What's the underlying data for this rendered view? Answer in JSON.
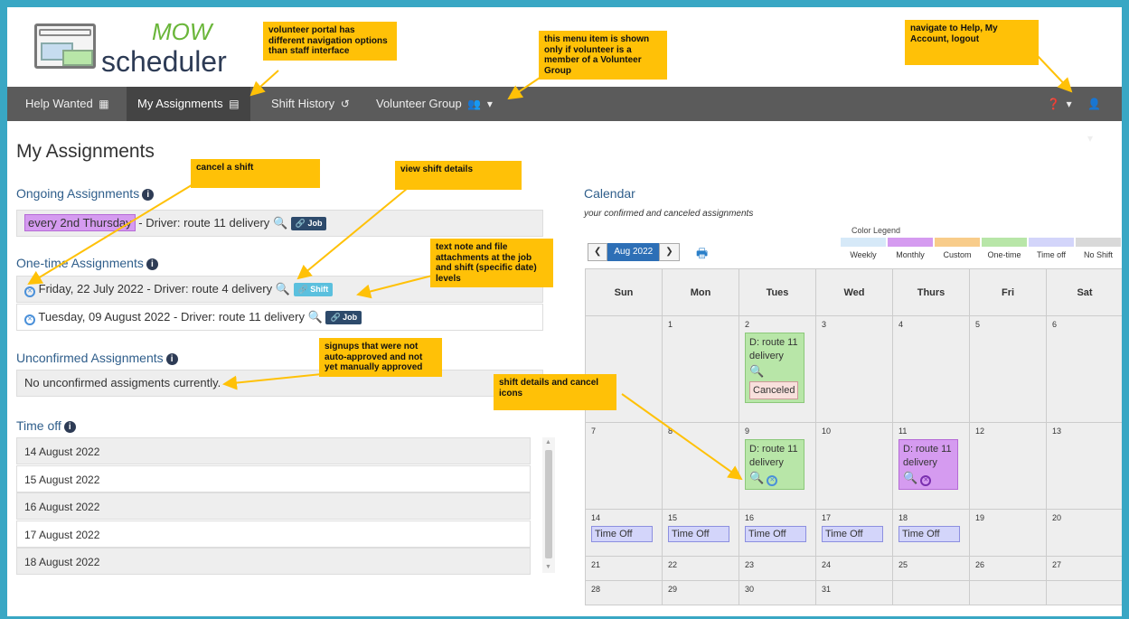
{
  "logo": {
    "mow": "MOW",
    "scheduler": "scheduler"
  },
  "nav": {
    "help_wanted": "Help Wanted",
    "my_assignments": "My Assignments",
    "shift_history": "Shift History",
    "volunteer_group": "Volunteer Group"
  },
  "page_title": "My Assignments",
  "ongoing": {
    "heading": "Ongoing Assignments",
    "pattern": "every 2nd Thursday",
    "sep": "-",
    "desc": "Driver: route 11 delivery",
    "badge": "Job"
  },
  "onetime": {
    "heading": "One-time Assignments",
    "rows": [
      {
        "date": "Friday, 22 July 2022 -",
        "desc": "Driver: route 4 delivery",
        "badge": "Shift"
      },
      {
        "date": "Tuesday, 09 August 2022 -",
        "desc": "Driver: route 11 delivery",
        "badge": "Job"
      }
    ]
  },
  "unconfirmed": {
    "heading": "Unconfirmed Assignments",
    "text": "No unconfirmed assigments currently."
  },
  "timeoff": {
    "heading": "Time off",
    "dates": [
      "14 August 2022",
      "15 August 2022",
      "16 August 2022",
      "17 August 2022",
      "18 August 2022"
    ]
  },
  "calendar": {
    "title": "Calendar",
    "subtitle": "your confirmed and canceled assignments",
    "month": "Aug 2022",
    "legend_title": "Color Legend",
    "legend": [
      {
        "label": "Weekly",
        "color": "#d6e9f8"
      },
      {
        "label": "Monthly",
        "color": "#d59bf0"
      },
      {
        "label": "Custom",
        "color": "#f8cc8a"
      },
      {
        "label": "One-time",
        "color": "#b8e6a8"
      },
      {
        "label": "Time off",
        "color": "#d3d5fa"
      },
      {
        "label": "No Shift",
        "color": "#d9d9d9"
      }
    ],
    "days": [
      "Sun",
      "Mon",
      "Tues",
      "Wed",
      "Thurs",
      "Fri",
      "Sat"
    ],
    "weeks": [
      [
        "",
        "1",
        "2",
        "3",
        "4",
        "5",
        "6"
      ],
      [
        "7",
        "8",
        "9",
        "10",
        "11",
        "12",
        "13"
      ],
      [
        "14",
        "15",
        "16",
        "17",
        "18",
        "19",
        "20"
      ],
      [
        "21",
        "22",
        "23",
        "24",
        "25",
        "26",
        "27"
      ],
      [
        "28",
        "29",
        "30",
        "31",
        "",
        "",
        ""
      ]
    ],
    "event_label": "D: route 11 delivery",
    "canceled_label": "Canceled",
    "timeoff_label": "Time Off"
  },
  "annotations": {
    "portal_nav": "volunteer portal has different navigation options than staff interface",
    "menu_item": "this menu item is shown only if volunteer is a member of a Volunteer Group",
    "help_account": "navigate to Help, My Account, logout",
    "cancel_shift": "cancel a shift",
    "view_details": "view shift details",
    "text_note": "text note and file attachments at the job and shift (specific date) levels",
    "signups": "signups that were not auto-approved and not yet manually approved",
    "shift_icons": "shift details and cancel icons"
  }
}
